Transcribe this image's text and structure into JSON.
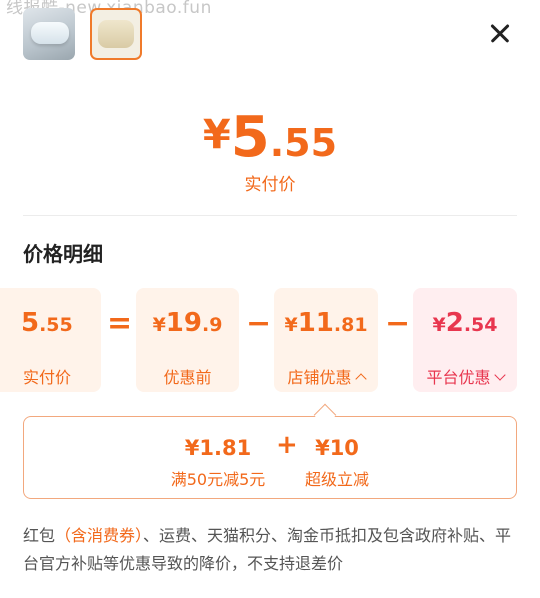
{
  "watermark": "线报酷-new.xianbao.fun",
  "hero": {
    "currency": "¥",
    "integer": "5",
    "decimal": ".55",
    "label": "实付价"
  },
  "section_title": "价格明细",
  "breakdown": [
    {
      "currency": "¥",
      "integer": "5",
      "decimal": ".55",
      "label": "实付价"
    },
    {
      "currency": "¥",
      "integer": "19",
      "decimal": ".9",
      "label": "优惠前"
    },
    {
      "currency": "¥",
      "integer": "11",
      "decimal": ".81",
      "label": "店铺优惠"
    },
    {
      "currency": "¥",
      "integer": "2",
      "decimal": ".54",
      "label": "平台优惠"
    }
  ],
  "operators": [
    "=",
    "−",
    "−"
  ],
  "shop_discount_detail": [
    {
      "value": "¥1.81",
      "label": "满50元减5元"
    },
    {
      "value": "¥10",
      "label": "超级立减"
    }
  ],
  "detail_operator": "+",
  "note": {
    "prefix": "红包",
    "highlight": "（含消费券）",
    "rest": "、运费、天猫积分、淘金币抵扣及包含政府补贴、平台官方补贴等优惠导致的降价，不支持退差价"
  },
  "colors": {
    "accent": "#f2691b",
    "platform": "#e8364f"
  }
}
